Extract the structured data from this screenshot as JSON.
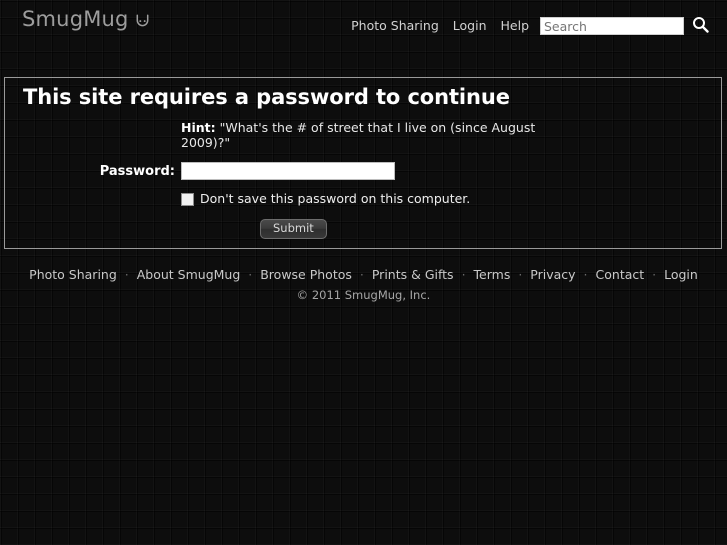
{
  "header": {
    "logo_text": "SmugMug",
    "logo_icon": "smiley-icon",
    "nav": [
      {
        "label": "Photo Sharing",
        "name": "header-nav-photo-sharing"
      },
      {
        "label": "Login",
        "name": "header-nav-login"
      },
      {
        "label": "Help",
        "name": "header-nav-help"
      }
    ],
    "search": {
      "placeholder": "Search",
      "value": "",
      "button_icon": "search-icon"
    }
  },
  "main": {
    "title": "This site requires a password to continue",
    "hint": {
      "label": "Hint:",
      "text": "\"What's the # of street that I live on (since August 2009)?\""
    },
    "password": {
      "label": "Password:",
      "value": "",
      "placeholder": ""
    },
    "remember": {
      "label": "Don't save this password on this computer.",
      "checked": false
    },
    "submit_label": "Submit"
  },
  "footer": {
    "links": [
      {
        "label": "Photo Sharing",
        "name": "footer-link-photo-sharing"
      },
      {
        "label": "About SmugMug",
        "name": "footer-link-about-smugmug"
      },
      {
        "label": "Browse Photos",
        "name": "footer-link-browse-photos"
      },
      {
        "label": "Prints & Gifts",
        "name": "footer-link-prints-and-gifts"
      },
      {
        "label": "Terms",
        "name": "footer-link-terms"
      },
      {
        "label": "Privacy",
        "name": "footer-link-privacy"
      },
      {
        "label": "Contact",
        "name": "footer-link-contact"
      },
      {
        "label": "Login",
        "name": "footer-link-login"
      }
    ],
    "separator": "·",
    "copyright": "© 2011 SmugMug, Inc."
  },
  "colors": {
    "page_background": "#0d0d0d",
    "panel_border": "#9a9a9a",
    "text_primary": "#ffffff",
    "text_muted": "#a6a6a6",
    "logo": "#9d9d9d",
    "input_background": "#ffffff"
  }
}
